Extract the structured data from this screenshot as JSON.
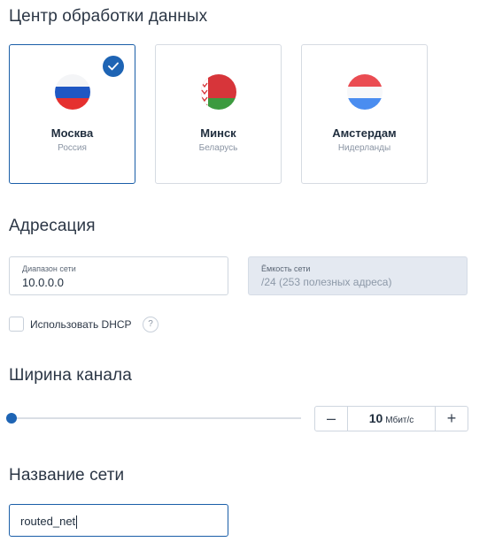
{
  "datacenter": {
    "title": "Центр обработки данных",
    "cards": [
      {
        "city": "Москва",
        "country": "Россия",
        "selected": true,
        "flag": "flag-russia"
      },
      {
        "city": "Минск",
        "country": "Беларусь",
        "selected": false,
        "flag": "flag-belarus"
      },
      {
        "city": "Амстердам",
        "country": "Нидерланды",
        "selected": false,
        "flag": "flag-netherlands"
      }
    ]
  },
  "addressing": {
    "title": "Адресация",
    "range": {
      "label": "Диапазон сети",
      "value": "10.0.0.0"
    },
    "capacity": {
      "label": "Ёмкость сети",
      "value": "/24 (253 полезных адреса)"
    },
    "dhcp_label": "Использовать DHCP",
    "dhcp_checked": false,
    "help_glyph": "?"
  },
  "bandwidth": {
    "title": "Ширина канала",
    "slider_level": 0,
    "value": "10",
    "unit": "Мбит/с",
    "minus": "–",
    "plus": "+"
  },
  "network_name": {
    "title": "Название сети",
    "value": "routed_net"
  },
  "colors": {
    "accent": "#1e64b4",
    "border": "#cfd6df",
    "readonly_bg": "#e4e9f1"
  }
}
